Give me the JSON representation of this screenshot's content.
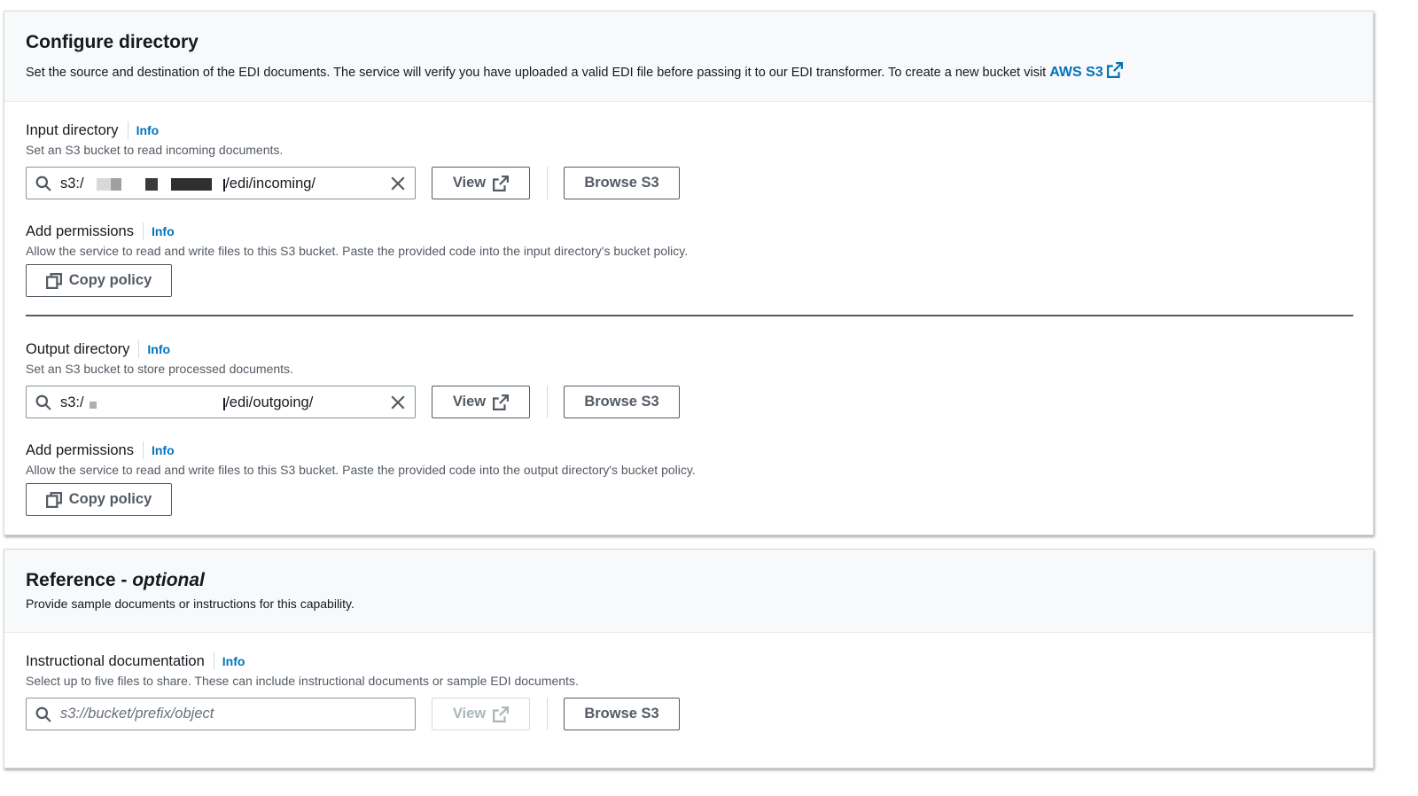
{
  "configure": {
    "title": "Configure directory",
    "description": "Set the source and destination of the EDI documents. The service will verify you have uploaded a valid EDI file before passing it to our EDI transformer. To create a new bucket visit",
    "link_label": "AWS S3"
  },
  "input_directory": {
    "label": "Input directory",
    "info": "Info",
    "description": "Set an S3 bucket to read incoming documents.",
    "value_prefix": "s3:/",
    "value_suffix": "/edi/incoming/",
    "view_label": "View",
    "browse_label": "Browse S3"
  },
  "input_permissions": {
    "label": "Add permissions",
    "info": "Info",
    "description": "Allow the service to read and write files to this S3 bucket. Paste the provided code into the input directory's bucket policy.",
    "button_label": "Copy policy"
  },
  "output_directory": {
    "label": "Output directory",
    "info": "Info",
    "description": "Set an S3 bucket to store processed documents.",
    "value_prefix": "s3:/",
    "value_suffix": "/edi/outgoing/",
    "view_label": "View",
    "browse_label": "Browse S3"
  },
  "output_permissions": {
    "label": "Add permissions",
    "info": "Info",
    "description": "Allow the service to read and write files to this S3 bucket. Paste the provided code into the output directory's bucket policy.",
    "button_label": "Copy policy"
  },
  "reference": {
    "title": "Reference",
    "title_separator": " - ",
    "title_optional": "optional",
    "description": "Provide sample documents or instructions for this capability."
  },
  "instructional_documentation": {
    "label": "Instructional documentation",
    "info": "Info",
    "description": "Select up to five files to share. These can include instructional documents or sample EDI documents.",
    "placeholder": "s3://bucket/prefix/object",
    "view_label": "View",
    "browse_label": "Browse S3"
  },
  "colors": {
    "link": "#0073bb",
    "text": "#16191f",
    "secondary_text": "#545b64",
    "button_border": "#545b64",
    "disabled": "#aab7b8"
  },
  "icons": [
    "search-icon",
    "clear-icon",
    "external-link-icon",
    "copy-icon"
  ]
}
